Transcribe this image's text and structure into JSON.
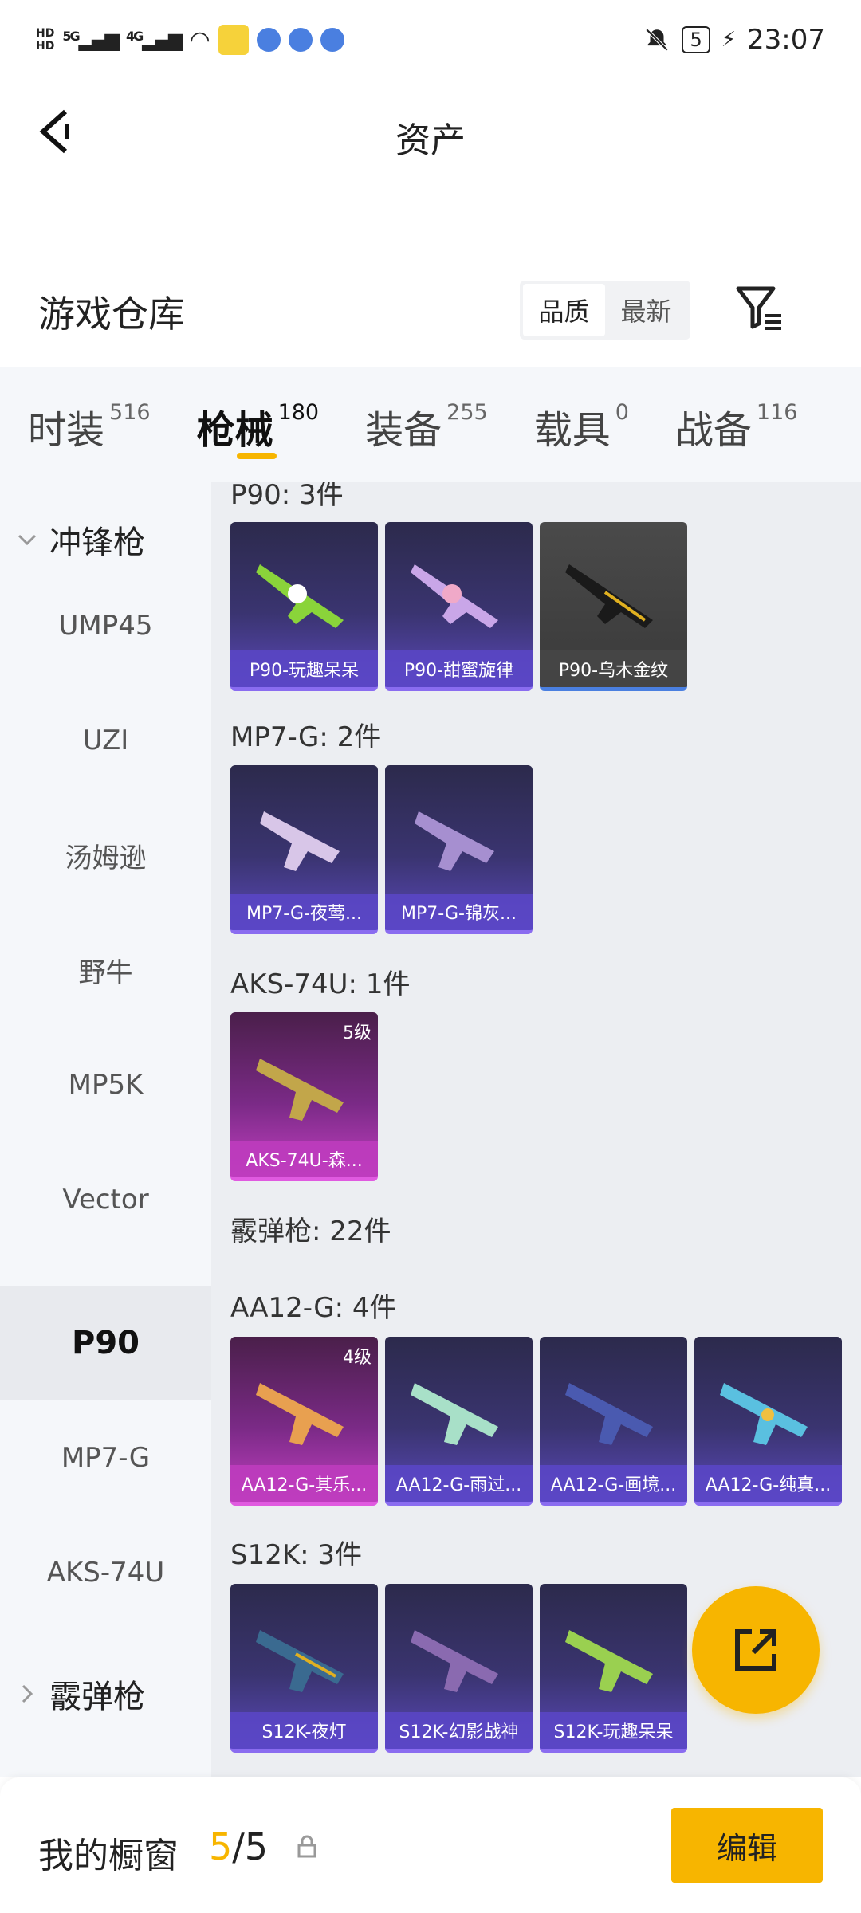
{
  "status_bar": {
    "hd1": "HD",
    "hd2": "HD",
    "net1": "5G",
    "net2": "4G",
    "battery": "5",
    "time": "23:07"
  },
  "header": {
    "title": "资产"
  },
  "section": {
    "title": "游戏仓库",
    "sort_options": [
      "品质",
      "最新"
    ],
    "active_sort": "品质"
  },
  "tabs": [
    {
      "label": "时装",
      "count": "516"
    },
    {
      "label": "枪械",
      "count": "180"
    },
    {
      "label": "装备",
      "count": "255"
    },
    {
      "label": "载具",
      "count": "0"
    },
    {
      "label": "战备",
      "count": "116"
    }
  ],
  "sidebar": {
    "group1": "冲锋枪",
    "items": [
      "UMP45",
      "UZI",
      "汤姆逊",
      "野牛",
      "MP5K",
      "Vector",
      "P90",
      "MP7-G",
      "AKS-74U"
    ],
    "active_item": "P90",
    "group2": "霰弹枪"
  },
  "content": {
    "p90_header": "P90: 3件",
    "p90_cards": [
      "P90-玩趣呆呆",
      "P90-甜蜜旋律",
      "P90-乌木金纹"
    ],
    "mp7_header": "MP7-G: 2件",
    "mp7_cards": [
      "MP7-G-夜莺...",
      "MP7-G-锦灰..."
    ],
    "aks_header": "AKS-74U: 1件",
    "aks_cards": [
      "AKS-74U-森..."
    ],
    "aks_level": "5级",
    "shotgun_header": "霰弹枪: 22件",
    "aa12_header": "AA12-G: 4件",
    "aa12_cards": [
      "AA12-G-其乐...",
      "AA12-G-雨过...",
      "AA12-G-画境...",
      "AA12-G-纯真..."
    ],
    "aa12_level": "4级",
    "s12k_header": "S12K: 3件",
    "s12k_cards": [
      "S12K-夜灯",
      "S12K-幻影战神",
      "S12K-玩趣呆呆"
    ]
  },
  "bottom": {
    "title": "我的橱窗",
    "count_current": "5",
    "count_sep": "/",
    "count_total": "5",
    "edit_label": "编辑"
  },
  "colors": {
    "accent": "#f7b500",
    "card_purple": "#5a48b8",
    "card_pink": "#c13fc0"
  }
}
